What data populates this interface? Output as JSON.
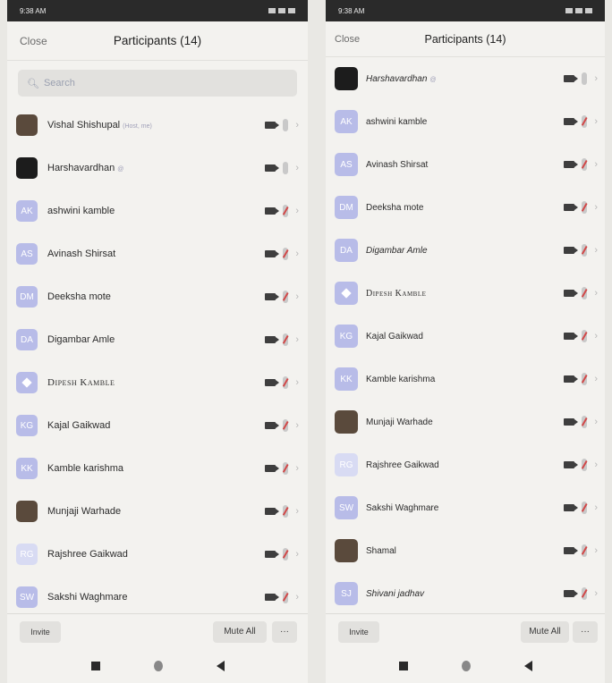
{
  "left": {
    "status_time": "9:38 AM",
    "header": {
      "close": "Close",
      "title": "Participants (14)"
    },
    "search_placeholder": "Search",
    "participants": [
      {
        "name": "Vishal Shishupal",
        "tag": "(Host, me)",
        "avatar": "photo",
        "initials": "",
        "mic": "on"
      },
      {
        "name": "Harshavardhan",
        "tag": "@",
        "avatar": "dark",
        "initials": "",
        "mic": "on"
      },
      {
        "name": "ashwini kamble",
        "tag": "",
        "avatar": "initials",
        "initials": "AK",
        "mic": "muted"
      },
      {
        "name": "Avinash Shirsat",
        "tag": "",
        "avatar": "initials",
        "initials": "AS",
        "mic": "muted"
      },
      {
        "name": "Deeksha mote",
        "tag": "",
        "avatar": "initials",
        "initials": "DM",
        "mic": "muted"
      },
      {
        "name": "Digambar Amle",
        "tag": "",
        "avatar": "initials",
        "initials": "DA",
        "mic": "muted"
      },
      {
        "name": "Dipesh Kamble",
        "tag": "",
        "avatar": "diamond",
        "initials": "",
        "mic": "muted",
        "style": "smallcaps"
      },
      {
        "name": "Kajal Gaikwad",
        "tag": "",
        "avatar": "initials",
        "initials": "KG",
        "mic": "muted"
      },
      {
        "name": "Kamble karishma",
        "tag": "",
        "avatar": "initials",
        "initials": "KK",
        "mic": "muted"
      },
      {
        "name": "Munjaji Warhade",
        "tag": "",
        "avatar": "photo",
        "initials": "",
        "mic": "muted"
      },
      {
        "name": "Rajshree Gaikwad",
        "tag": "",
        "avatar": "light",
        "initials": "RG",
        "mic": "muted"
      },
      {
        "name": "Sakshi Waghmare",
        "tag": "",
        "avatar": "initials",
        "initials": "SW",
        "mic": "muted"
      }
    ],
    "footer": {
      "invite": "Invite",
      "mute_all": "Mute All",
      "more": "···"
    }
  },
  "right": {
    "status_time": "9:38 AM",
    "header": {
      "close": "Close",
      "title": "Participants (14)"
    },
    "participants": [
      {
        "name": "Harshavardhan",
        "tag": "@",
        "avatar": "dark",
        "initials": "",
        "mic": "on",
        "style": "italic"
      },
      {
        "name": "ashwini kamble",
        "tag": "",
        "avatar": "initials",
        "initials": "AK",
        "mic": "muted"
      },
      {
        "name": "Avinash Shirsat",
        "tag": "",
        "avatar": "initials",
        "initials": "AS",
        "mic": "muted"
      },
      {
        "name": "Deeksha mote",
        "tag": "",
        "avatar": "initials",
        "initials": "DM",
        "mic": "muted"
      },
      {
        "name": "Digambar Amle",
        "tag": "",
        "avatar": "initials",
        "initials": "DA",
        "mic": "muted",
        "style": "italic"
      },
      {
        "name": "Dipesh Kamble",
        "tag": "",
        "avatar": "diamond",
        "initials": "",
        "mic": "muted",
        "style": "smallcaps"
      },
      {
        "name": "Kajal Gaikwad",
        "tag": "",
        "avatar": "initials",
        "initials": "KG",
        "mic": "muted"
      },
      {
        "name": "Kamble karishma",
        "tag": "",
        "avatar": "initials",
        "initials": "KK",
        "mic": "muted"
      },
      {
        "name": "Munjaji Warhade",
        "tag": "",
        "avatar": "photo",
        "initials": "",
        "mic": "muted"
      },
      {
        "name": "Rajshree Gaikwad",
        "tag": "",
        "avatar": "light",
        "initials": "RG",
        "mic": "muted"
      },
      {
        "name": "Sakshi Waghmare",
        "tag": "",
        "avatar": "initials",
        "initials": "SW",
        "mic": "muted"
      },
      {
        "name": "Shamal",
        "tag": "",
        "avatar": "photo",
        "initials": "",
        "mic": "muted"
      },
      {
        "name": "Shivani jadhav",
        "tag": "",
        "avatar": "initials",
        "initials": "SJ",
        "mic": "muted",
        "style": "italic"
      }
    ],
    "footer": {
      "invite": "Invite",
      "mute_all": "Mute All",
      "more": "···"
    }
  },
  "icons": {
    "camera": "video-camera-icon",
    "mic": "microphone-icon",
    "chevron": "chevron-right-icon",
    "search": "search-icon"
  },
  "colors": {
    "avatar_initials_bg": "#b8bce8",
    "mute_slash": "#d24848",
    "background": "#f3f2ef"
  }
}
